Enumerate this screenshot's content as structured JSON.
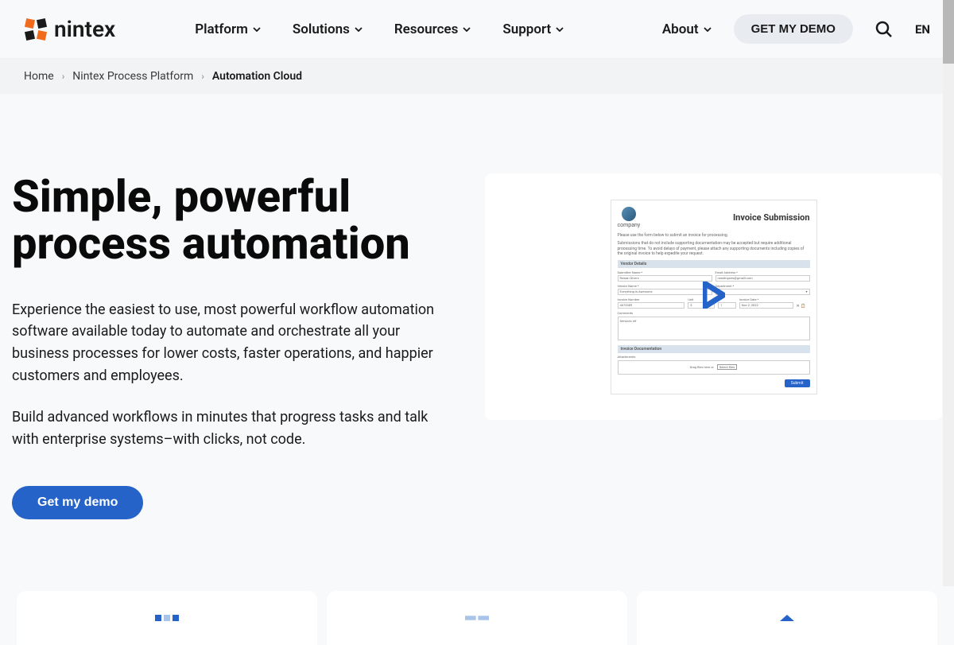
{
  "header": {
    "logo_text": "nintex",
    "nav": [
      {
        "label": "Platform"
      },
      {
        "label": "Solutions"
      },
      {
        "label": "Resources"
      },
      {
        "label": "Support"
      }
    ],
    "about_label": "About",
    "demo_btn": "GET MY DEMO",
    "lang": "EN"
  },
  "breadcrumb": {
    "items": [
      {
        "label": "Home"
      },
      {
        "label": "Nintex Process Platform"
      }
    ],
    "current": "Automation Cloud"
  },
  "hero": {
    "title": "Simple, powerful process automation",
    "desc1": "Experience the easiest to use, most powerful workflow automation software available today to automate and orchestrate all your business processes for lower costs, faster operations, and happier customers and employees.",
    "desc2": "Build advanced workflows in minutes that progress tasks and talk with enterprise systems–with clicks, not code.",
    "cta": "Get my demo"
  },
  "form_mock": {
    "company_label": "company",
    "title": "Invoice Submission",
    "intro": "Please use the form below to submit an invoice for processing.",
    "note": "Submissions that do not include supporting documentation may be accepted but require additional processing time. To avoid delays of payment, please attach any supporting documents including copies of the original invoice to help expedite your request.",
    "section1": "Vendor Details",
    "fields": {
      "submitter_name_label": "Submitter Name *",
      "submitter_name": "Rowan Divers",
      "email_label": "Email Address *",
      "email": "rowdingoes@gmaill.com",
      "vendor_name_label": "Vendor Name *",
      "vendor_name": "Everything is Awesome",
      "department_label": "Department *",
      "department": "Eng",
      "invoice_number_label": "Invoice Number",
      "invoice_number": "4673389",
      "unit_label": "Unit",
      "unit": "$",
      "qty": "1",
      "invoice_date_label": "Invoice Date *",
      "invoice_date": "Nov 2, 2022",
      "comments_label": "Comments",
      "comments": "Services ref"
    },
    "section2": "Invoice Documentation",
    "attachments_label": "Attachments",
    "drop_text": "Drag files here or",
    "select_files": "Select files",
    "submit": "Submit"
  }
}
